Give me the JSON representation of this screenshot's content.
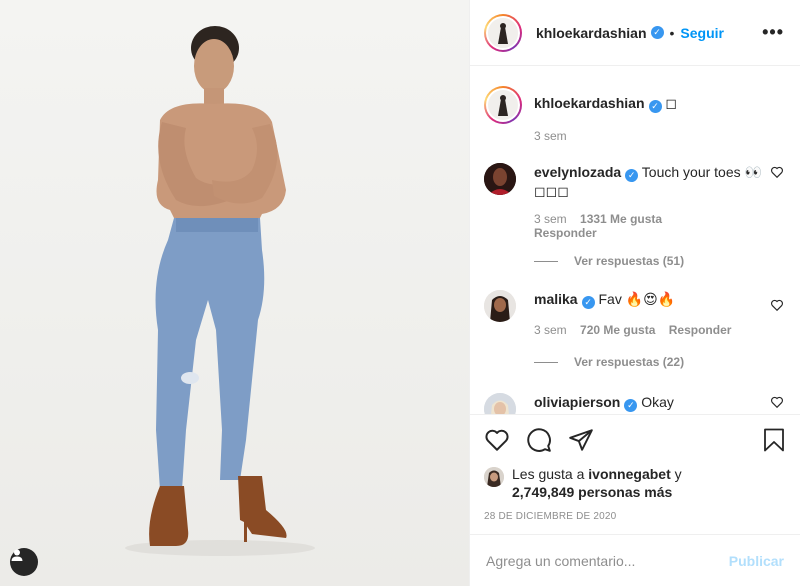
{
  "header": {
    "username": "khloekardashian",
    "follow_label": "Seguir",
    "separator": "•",
    "more": "•••"
  },
  "caption": {
    "username": "khloekardashian",
    "text": "◻",
    "time": "3 sem"
  },
  "comments": [
    {
      "username": "evelynlozada",
      "text": "Touch your toes 👀◻◻◻",
      "time": "3 sem",
      "likes": "1331 Me gusta",
      "reply": "Responder",
      "view_replies": "Ver respuestas (51)"
    },
    {
      "username": "malika",
      "text": "Fav 🔥😍🔥",
      "time": "3 sem",
      "likes": "720 Me gusta",
      "reply": "Responder",
      "view_replies": "Ver respuestas (22)"
    },
    {
      "username": "oliviapierson",
      "text": "Okay"
    }
  ],
  "likes": {
    "prefix": "Les gusta a ",
    "user": "ivonnegabet",
    "suffix": " y",
    "others": "2,749,849 personas más"
  },
  "date": "28 DE DICIEMBRE DE 2020",
  "composer": {
    "placeholder": "Agrega un comentario...",
    "publish": "Publicar"
  },
  "icons": {
    "like": "heart-icon",
    "comment": "comment-icon",
    "share": "share-icon",
    "save": "bookmark-icon",
    "tag": "user-tag-icon"
  },
  "colors": {
    "link_blue": "#0095f6",
    "verified_blue": "#3897f0",
    "muted": "#8e8e8e",
    "publish_disabled": "#b2dffc"
  }
}
